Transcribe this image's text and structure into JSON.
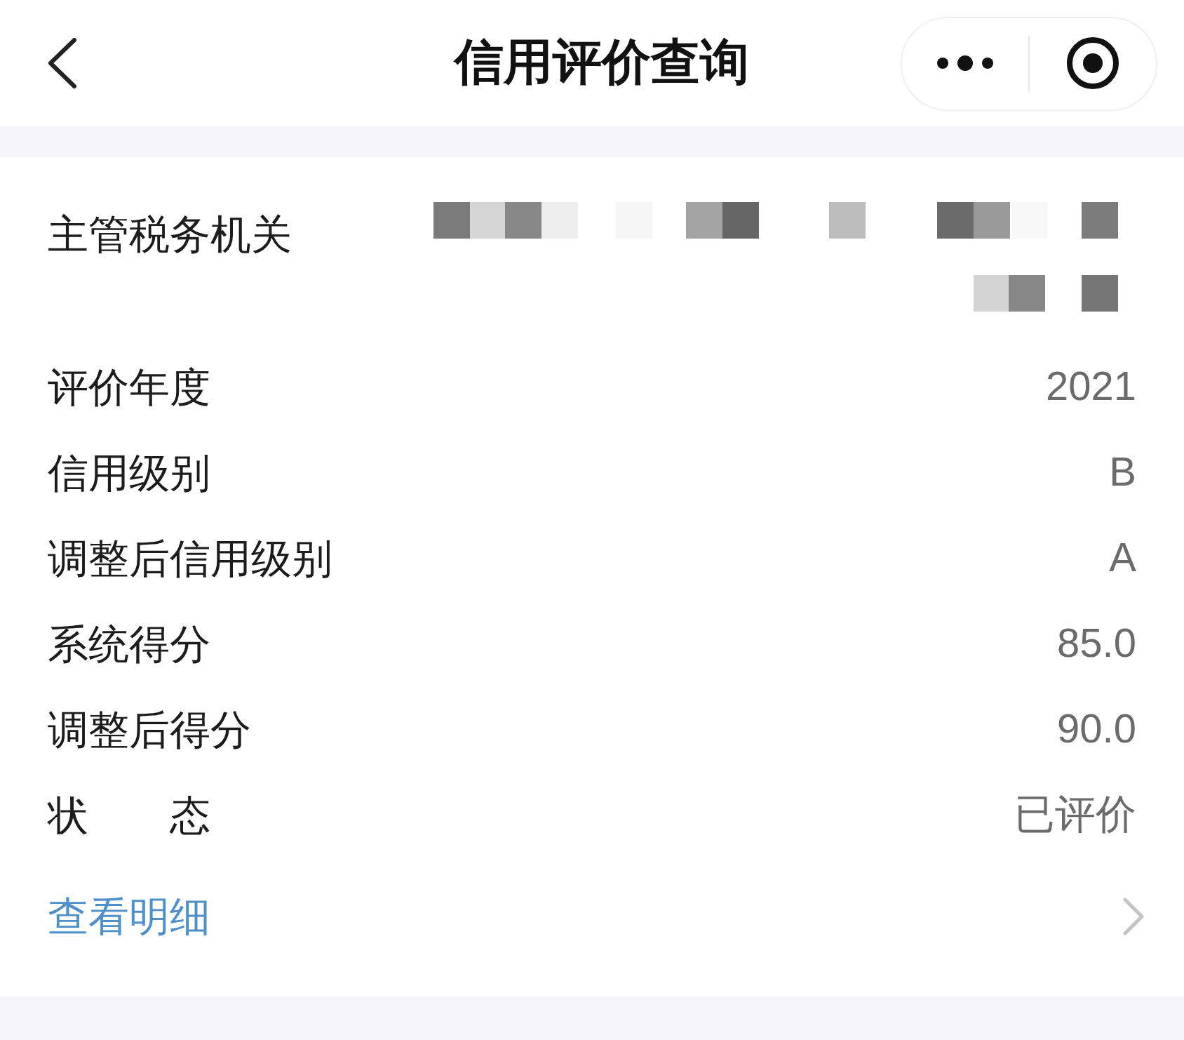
{
  "nav_bar": {
    "title": "信用评价查询"
  },
  "info": {
    "rows": [
      {
        "kind": "redacted",
        "label": "主管税务机关"
      },
      {
        "kind": "text",
        "label": "评价年度",
        "value": "2021"
      },
      {
        "kind": "text",
        "label": "信用级别",
        "value": "B"
      },
      {
        "kind": "text",
        "label": "调整后信用级别",
        "value": "A"
      },
      {
        "kind": "text",
        "label": "系统得分",
        "value": "85.0"
      },
      {
        "kind": "text",
        "label": "调整后得分",
        "value": "90.0"
      },
      {
        "kind": "text",
        "label": "状　　态",
        "value": "已评价"
      }
    ],
    "detail_link": {
      "label": "查看明细"
    }
  }
}
